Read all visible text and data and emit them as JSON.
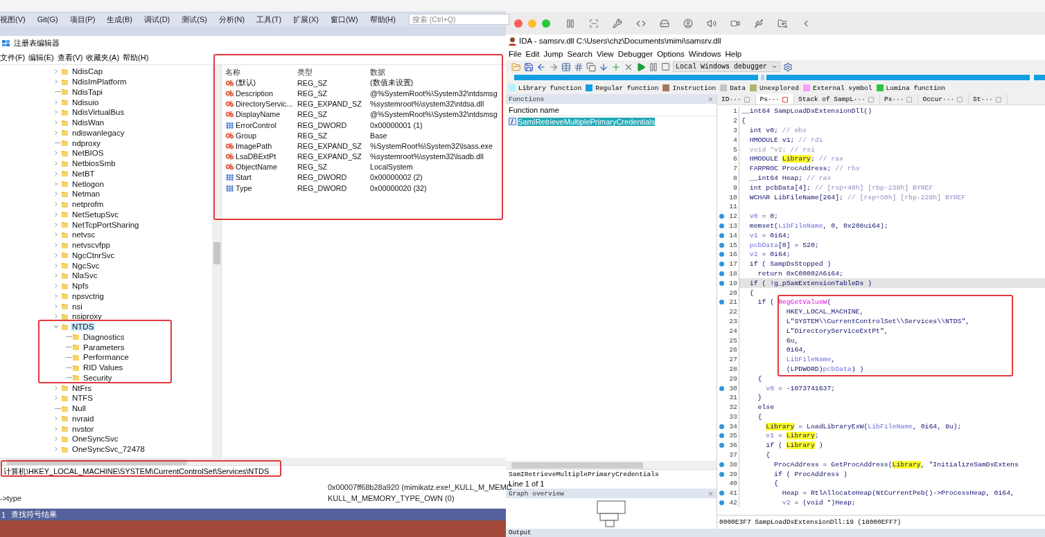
{
  "vs": {
    "menu": [
      "视图(V)",
      "Git(G)",
      "项目(P)",
      "生成(B)",
      "调试(D)",
      "测试(S)",
      "分析(N)",
      "工具(T)",
      "扩展(X)",
      "窗口(W)",
      "帮助(H)"
    ],
    "search": {
      "placeholder": "搜索 (Ctrl+Q)"
    }
  },
  "regedit": {
    "title": "注册表编辑器",
    "menu": [
      "文件(F)",
      "编辑(E)",
      "查看(V)",
      "收藏夹(A)",
      "帮助(H)"
    ],
    "tree": [
      {
        "label": "NdisCap",
        "kind": "collapsed",
        "selected": false
      },
      {
        "label": "NdisImPlatform",
        "kind": "collapsed",
        "selected": false
      },
      {
        "label": "NdisTapi",
        "kind": "leaf",
        "selected": false
      },
      {
        "label": "Ndisuio",
        "kind": "collapsed",
        "selected": false
      },
      {
        "label": "NdisVirtualBus",
        "kind": "collapsed",
        "selected": false
      },
      {
        "label": "NdisWan",
        "kind": "collapsed",
        "selected": false
      },
      {
        "label": "ndiswanlegacy",
        "kind": "collapsed",
        "selected": false
      },
      {
        "label": "ndproxy",
        "kind": "leaf",
        "selected": false
      },
      {
        "label": "NetBIOS",
        "kind": "collapsed",
        "selected": false
      },
      {
        "label": "NetbiosSmb",
        "kind": "collapsed",
        "selected": false
      },
      {
        "label": "NetBT",
        "kind": "collapsed",
        "selected": false
      },
      {
        "label": "Netlogon",
        "kind": "collapsed",
        "selected": false
      },
      {
        "label": "Netman",
        "kind": "collapsed",
        "selected": false
      },
      {
        "label": "netprofm",
        "kind": "collapsed",
        "selected": false
      },
      {
        "label": "NetSetupSvc",
        "kind": "collapsed",
        "selected": false
      },
      {
        "label": "NetTcpPortSharing",
        "kind": "collapsed",
        "selected": false
      },
      {
        "label": "netvsc",
        "kind": "collapsed",
        "selected": false
      },
      {
        "label": "netvscvfpp",
        "kind": "collapsed",
        "selected": false
      },
      {
        "label": "NgcCtnrSvc",
        "kind": "collapsed",
        "selected": false
      },
      {
        "label": "NgcSvc",
        "kind": "collapsed",
        "selected": false
      },
      {
        "label": "NlaSvc",
        "kind": "collapsed",
        "selected": false
      },
      {
        "label": "Npfs",
        "kind": "collapsed",
        "selected": false
      },
      {
        "label": "npsvctrig",
        "kind": "collapsed",
        "selected": false
      },
      {
        "label": "nsi",
        "kind": "collapsed",
        "selected": false
      },
      {
        "label": "nsiproxy",
        "kind": "collapsed",
        "selected": false
      },
      {
        "label": "NTDS",
        "kind": "expanded",
        "selected": true,
        "outlined": true,
        "children": [
          {
            "label": "Diagnostics",
            "kind": "leaf",
            "selected": false
          },
          {
            "label": "Parameters",
            "kind": "leaf",
            "selected": false
          },
          {
            "label": "Performance",
            "kind": "leaf",
            "selected": false
          },
          {
            "label": "RID Values",
            "kind": "leaf",
            "selected": false
          },
          {
            "label": "Security",
            "kind": "leaf",
            "selected": false
          }
        ]
      },
      {
        "label": "NtFrs",
        "kind": "collapsed",
        "selected": false
      },
      {
        "label": "NTFS",
        "kind": "collapsed",
        "selected": false
      },
      {
        "label": "Null",
        "kind": "leaf",
        "selected": false
      },
      {
        "label": "nvraid",
        "kind": "collapsed",
        "selected": false
      },
      {
        "label": "nvstor",
        "kind": "collapsed",
        "selected": false
      },
      {
        "label": "OneSyncSvc",
        "kind": "collapsed",
        "selected": false
      },
      {
        "label": "OneSyncSvc_72478",
        "kind": "collapsed",
        "selected": false
      }
    ],
    "values": {
      "outlined": true,
      "columns": [
        "名称",
        "类型",
        "数据"
      ],
      "rows": [
        {
          "kind": "string",
          "name": "(默认)",
          "type": "REG_SZ",
          "data": "(数值未设置)"
        },
        {
          "kind": "string",
          "name": "Description",
          "type": "REG_SZ",
          "data": "@%SystemRoot%\\System32\\ntdsmsg"
        },
        {
          "kind": "string",
          "name": "DirectoryServic...",
          "type": "REG_EXPAND_SZ",
          "data": "%systemroot%\\system32\\ntdsa.dll"
        },
        {
          "kind": "string",
          "name": "DisplayName",
          "type": "REG_SZ",
          "data": "@%SystemRoot%\\System32\\ntdsmsg"
        },
        {
          "kind": "dword",
          "name": "ErrorControl",
          "type": "REG_DWORD",
          "data": "0x00000001 (1)"
        },
        {
          "kind": "string",
          "name": "Group",
          "type": "REG_SZ",
          "data": "Base"
        },
        {
          "kind": "string",
          "name": "ImagePath",
          "type": "REG_EXPAND_SZ",
          "data": "%SystemRoot%\\System32\\lsass.exe"
        },
        {
          "kind": "string",
          "name": "LsaDBExtPt",
          "type": "REG_EXPAND_SZ",
          "data": "%systemroot%\\system32\\lsadb.dll"
        },
        {
          "kind": "string",
          "name": "ObjectName",
          "type": "REG_SZ",
          "data": "LocalSystem"
        },
        {
          "kind": "dword",
          "name": "Start",
          "type": "REG_DWORD",
          "data": "0x00000002 (2)"
        },
        {
          "kind": "dword",
          "name": "Type",
          "type": "REG_DWORD",
          "data": "0x00000020 (32)"
        }
      ]
    },
    "address": {
      "text": "计算机\\HKEY_LOCAL_MACHINE\\SYSTEM\\CurrentControlSet\\Services\\NTDS",
      "outlined": true
    }
  },
  "output": {
    "rows": [
      {
        "value": "0x00007ff68b28a920 (mimikatz.exe!_KULL_M_MEMC"
      },
      {
        "name": "->type",
        "value": "KULL_M_MEMORY_TYPE_OWN (0)"
      }
    ]
  },
  "status_bar": {
    "items": [
      "1",
      "查找符号结果"
    ]
  },
  "ida": {
    "title": "IDA - samsrv.dll C:\\Users\\chz\\Documents\\mimi\\samsrv.dll",
    "menu": [
      "File",
      "Edit",
      "Jump",
      "Search",
      "View",
      "Debugger",
      "Options",
      "Windows",
      "Help"
    ],
    "debugger": "Local Windows debugger",
    "legend": [
      {
        "label": "Library function",
        "color": "#aef3ff"
      },
      {
        "label": "Regular function",
        "color": "#0aa0e6"
      },
      {
        "label": "Instruction",
        "color": "#a6765e"
      },
      {
        "label": "Data",
        "color": "#c4c4c4"
      },
      {
        "label": "Unexplored",
        "color": "#b3b36e"
      },
      {
        "label": "External symbol",
        "color": "#ff9cff"
      },
      {
        "label": "Lumina function",
        "color": "#2ec43a"
      }
    ],
    "functions": {
      "title": "Functions",
      "column": "Function name",
      "items": [
        {
          "label": "SamIRetrieveMultiplePrimaryCredentials",
          "selected": true
        }
      ],
      "current": "SamIRetrieveMultiplePrimaryCredentials",
      "count": "Line 1 of 1"
    },
    "graph_overview": {
      "title": "Graph overview"
    },
    "tabs": [
      {
        "label": "ID···",
        "selected": false
      },
      {
        "label": "Ps···",
        "selected": true
      },
      {
        "label": "Stack of SampL···",
        "selected": false
      },
      {
        "label": "Ps···",
        "selected": false
      },
      {
        "label": "Occur···",
        "selected": false
      },
      {
        "label": "St···",
        "selected": false
      }
    ],
    "code": {
      "outlined": true,
      "lines": [
        {
          "n": "1",
          "dot": false,
          "selected": false,
          "tokens": [
            {
              "kind": "p",
              "text": "__int64 SampLoadDsExtensionDll()"
            }
          ]
        },
        {
          "n": "2",
          "dot": false,
          "selected": false,
          "tokens": [
            {
              "kind": "p",
              "text": "{"
            }
          ]
        },
        {
          "n": "3",
          "dot": false,
          "selected": false,
          "tokens": [
            {
              "kind": "p",
              "text": "  int v0; "
            },
            {
              "kind": "c",
              "text": "// ebx"
            }
          ]
        },
        {
          "n": "4",
          "dot": false,
          "selected": false,
          "tokens": [
            {
              "kind": "p",
              "text": "  HMODULE v1; "
            },
            {
              "kind": "c",
              "text": "// rdi"
            }
          ]
        },
        {
          "n": "5",
          "dot": false,
          "selected": false,
          "tokens": [
            {
              "kind": "g",
              "text": "  void *v2; "
            },
            {
              "kind": "c",
              "text": "// rsi"
            }
          ]
        },
        {
          "n": "6",
          "dot": false,
          "selected": false,
          "tokens": [
            {
              "kind": "p",
              "text": "  HMODULE "
            },
            {
              "kind": "h",
              "text": "Library"
            },
            {
              "kind": "p",
              "text": "; "
            },
            {
              "kind": "c",
              "text": "// rax"
            }
          ]
        },
        {
          "n": "7",
          "dot": false,
          "selected": false,
          "tokens": [
            {
              "kind": "p",
              "text": "  FARPROC ProcAddress; "
            },
            {
              "kind": "c",
              "text": "// rbx"
            }
          ]
        },
        {
          "n": "8",
          "dot": false,
          "selected": false,
          "tokens": [
            {
              "kind": "p",
              "text": "  __int64 Heap; "
            },
            {
              "kind": "c",
              "text": "// rax"
            }
          ]
        },
        {
          "n": "9",
          "dot": false,
          "selected": false,
          "tokens": [
            {
              "kind": "p",
              "text": "  int pcbData[4]; "
            },
            {
              "kind": "c",
              "text": "// [rsp+40h] [rbp-238h] BYREF"
            }
          ]
        },
        {
          "n": "10",
          "dot": false,
          "selected": false,
          "tokens": [
            {
              "kind": "p",
              "text": "  WCHAR LibFileName[264]; "
            },
            {
              "kind": "c",
              "text": "// [rsp+50h] [rbp-228h] BYREF"
            }
          ]
        },
        {
          "n": "11",
          "dot": false,
          "selected": false
        },
        {
          "n": "12",
          "dot": true,
          "selected": false,
          "tokens": [
            {
              "kind": "v",
              "text": "  v0"
            },
            {
              "kind": "p",
              "text": " = 0;"
            }
          ]
        },
        {
          "n": "13",
          "dot": true,
          "selected": false,
          "tokens": [
            {
              "kind": "p",
              "text": "  memset("
            },
            {
              "kind": "v",
              "text": "LibFileName"
            },
            {
              "kind": "p",
              "text": ", 0, 0x208ui64);"
            }
          ]
        },
        {
          "n": "14",
          "dot": true,
          "selected": false,
          "tokens": [
            {
              "kind": "v",
              "text": "  v1"
            },
            {
              "kind": "p",
              "text": " = 0i64;"
            }
          ]
        },
        {
          "n": "15",
          "dot": true,
          "selected": false,
          "tokens": [
            {
              "kind": "v",
              "text": "  pcbData"
            },
            {
              "kind": "p",
              "text": "[0] = 520;"
            }
          ]
        },
        {
          "n": "16",
          "dot": true,
          "selected": false,
          "tokens": [
            {
              "kind": "v",
              "text": "  v2"
            },
            {
              "kind": "p",
              "text": " = 0i64;"
            }
          ]
        },
        {
          "n": "17",
          "dot": true,
          "selected": false,
          "tokens": [
            {
              "kind": "p",
              "text": "  if ( SampDsStopped )"
            }
          ]
        },
        {
          "n": "18",
          "dot": true,
          "selected": false,
          "tokens": [
            {
              "kind": "p",
              "text": "    return 0xC00002A6i64;"
            }
          ]
        },
        {
          "n": "19",
          "dot": true,
          "selected": true,
          "tokens": [
            {
              "kind": "p",
              "text": "  if ( !g_pSamExtensionTableDs )"
            }
          ]
        },
        {
          "n": "20",
          "dot": false,
          "selected": false,
          "tokens": [
            {
              "kind": "p",
              "text": "  {"
            }
          ]
        },
        {
          "n": "21",
          "dot": true,
          "selected": false,
          "tokens": [
            {
              "kind": "p",
              "text": "    if ( "
            },
            {
              "kind": "m",
              "text": "RegGetValueW"
            },
            {
              "kind": "p",
              "text": "("
            }
          ]
        },
        {
          "n": "22",
          "dot": false,
          "selected": false,
          "tokens": [
            {
              "kind": "p",
              "text": "           HKEY_LOCAL_MACHINE,"
            }
          ]
        },
        {
          "n": "23",
          "dot": false,
          "selected": false,
          "tokens": [
            {
              "kind": "p",
              "text": "           L\"SYSTEM\\\\CurrentControlSet\\\\Services\\\\NTDS\","
            }
          ]
        },
        {
          "n": "24",
          "dot": false,
          "selected": false,
          "tokens": [
            {
              "kind": "p",
              "text": "           L\"DirectoryServiceExtPt\","
            }
          ]
        },
        {
          "n": "25",
          "dot": false,
          "selected": false,
          "tokens": [
            {
              "kind": "p",
              "text": "           6u,"
            }
          ]
        },
        {
          "n": "26",
          "dot": false,
          "selected": false,
          "tokens": [
            {
              "kind": "p",
              "text": "           0i64,"
            }
          ]
        },
        {
          "n": "27",
          "dot": false,
          "selected": false,
          "tokens": [
            {
              "kind": "v",
              "text": "           LibFileName"
            },
            {
              "kind": "p",
              "text": ","
            }
          ]
        },
        {
          "n": "28",
          "dot": false,
          "selected": false,
          "tokens": [
            {
              "kind": "p",
              "text": "           (LPDWORD)"
            },
            {
              "kind": "v",
              "text": "pcbData"
            },
            {
              "kind": "p",
              "text": ") )"
            }
          ]
        },
        {
          "n": "29",
          "dot": false,
          "selected": false,
          "tokens": [
            {
              "kind": "p",
              "text": "    {"
            }
          ]
        },
        {
          "n": "30",
          "dot": true,
          "selected": false,
          "tokens": [
            {
              "kind": "v",
              "text": "      v0"
            },
            {
              "kind": "p",
              "text": " = -1073741637;"
            }
          ]
        },
        {
          "n": "31",
          "dot": false,
          "selected": false,
          "tokens": [
            {
              "kind": "p",
              "text": "    }"
            }
          ]
        },
        {
          "n": "32",
          "dot": false,
          "selected": false,
          "tokens": [
            {
              "kind": "p",
              "text": "    else"
            }
          ]
        },
        {
          "n": "33",
          "dot": false,
          "selected": false,
          "tokens": [
            {
              "kind": "p",
              "text": "    {"
            }
          ]
        },
        {
          "n": "34",
          "dot": true,
          "selected": false,
          "tokens": [
            {
              "kind": "h",
              "text": "      Library"
            },
            {
              "kind": "p",
              "text": " = LoadLibraryExW("
            },
            {
              "kind": "v",
              "text": "LibFileName"
            },
            {
              "kind": "p",
              "text": ", 0i64, 8u);"
            }
          ]
        },
        {
          "n": "35",
          "dot": true,
          "selected": false,
          "tokens": [
            {
              "kind": "v",
              "text": "      v1"
            },
            {
              "kind": "p",
              "text": " = "
            },
            {
              "kind": "h",
              "text": "Library"
            },
            {
              "kind": "p",
              "text": ";"
            }
          ]
        },
        {
          "n": "36",
          "dot": true,
          "selected": false,
          "tokens": [
            {
              "kind": "p",
              "text": "      if ( "
            },
            {
              "kind": "h",
              "text": "Library"
            },
            {
              "kind": "p",
              "text": " )"
            }
          ]
        },
        {
          "n": "37",
          "dot": false,
          "selected": false,
          "tokens": [
            {
              "kind": "p",
              "text": "      {"
            }
          ]
        },
        {
          "n": "38",
          "dot": true,
          "selected": false,
          "tokens": [
            {
              "kind": "p",
              "text": "        ProcAddress = GetProcAddress("
            },
            {
              "kind": "h",
              "text": "Library"
            },
            {
              "kind": "p",
              "text": ", \"InitializeSamDsExtens"
            }
          ]
        },
        {
          "n": "39",
          "dot": true,
          "selected": false,
          "tokens": [
            {
              "kind": "p",
              "text": "        if ( ProcAddress )"
            }
          ]
        },
        {
          "n": "40",
          "dot": false,
          "selected": false,
          "tokens": [
            {
              "kind": "p",
              "text": "        {"
            }
          ]
        },
        {
          "n": "41",
          "dot": true,
          "selected": false,
          "tokens": [
            {
              "kind": "p",
              "text": "          Heap = RtlAllocateHeap(NtCurrentPeb()->ProcessHeap, 0i64,"
            }
          ]
        },
        {
          "n": "42",
          "dot": true,
          "selected": false,
          "tokens": [
            {
              "kind": "v",
              "text": "          v2"
            },
            {
              "kind": "p",
              "text": " = (void *)Heap;"
            }
          ]
        }
      ]
    },
    "code_status": "0000E3F7 SampLoadDsExtensionDll:19 (18000EFF7)",
    "output_title": "Output"
  }
}
